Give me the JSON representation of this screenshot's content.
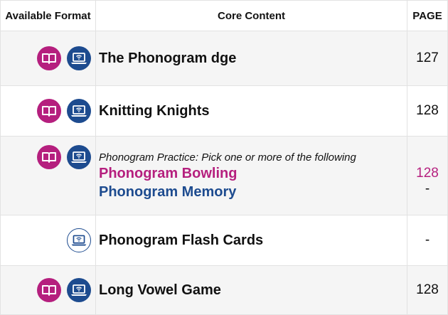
{
  "headers": {
    "format": "Available Format",
    "content": "Core Content",
    "page": "PAGE"
  },
  "colors": {
    "print": "#b51f7e",
    "digital": "#1d4b8f"
  },
  "icons": {
    "print": "book-icon",
    "digital": "laptop-wifi-icon"
  },
  "rows": [
    {
      "title": "The Phonogram dge",
      "page": "127",
      "formats": [
        "print",
        "digital"
      ]
    },
    {
      "title": "Knitting Knights",
      "page": "128",
      "formats": [
        "print",
        "digital"
      ]
    },
    {
      "intro": "Phonogram Practice: Pick one or more of the following",
      "option_a": "Phonogram Bowling",
      "option_b": "Phonogram Memory",
      "page_a": "128",
      "page_b": "-",
      "formats": [
        "print",
        "digital"
      ]
    },
    {
      "title": "Phonogram Flash Cards",
      "page": "-",
      "formats": [
        "digital-outline"
      ]
    },
    {
      "title": "Long Vowel Game",
      "page": "128",
      "formats": [
        "print",
        "digital"
      ]
    }
  ]
}
